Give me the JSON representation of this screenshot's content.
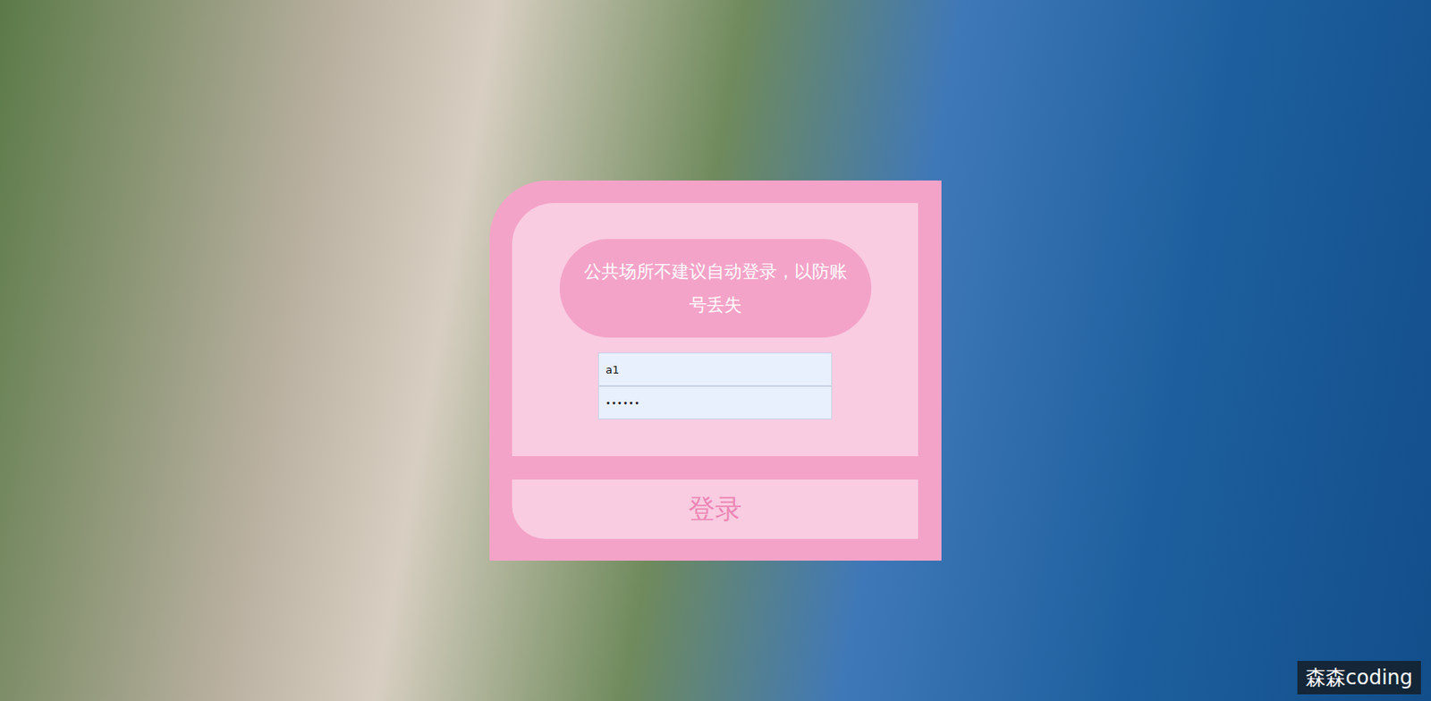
{
  "notice": "公共场所不建议自动登录，以防账号丢失",
  "fields": [
    {
      "kind": "text",
      "value": "a1"
    },
    {
      "kind": "password",
      "value": "••••••"
    }
  ],
  "button": "登录",
  "watermark": "森森coding"
}
